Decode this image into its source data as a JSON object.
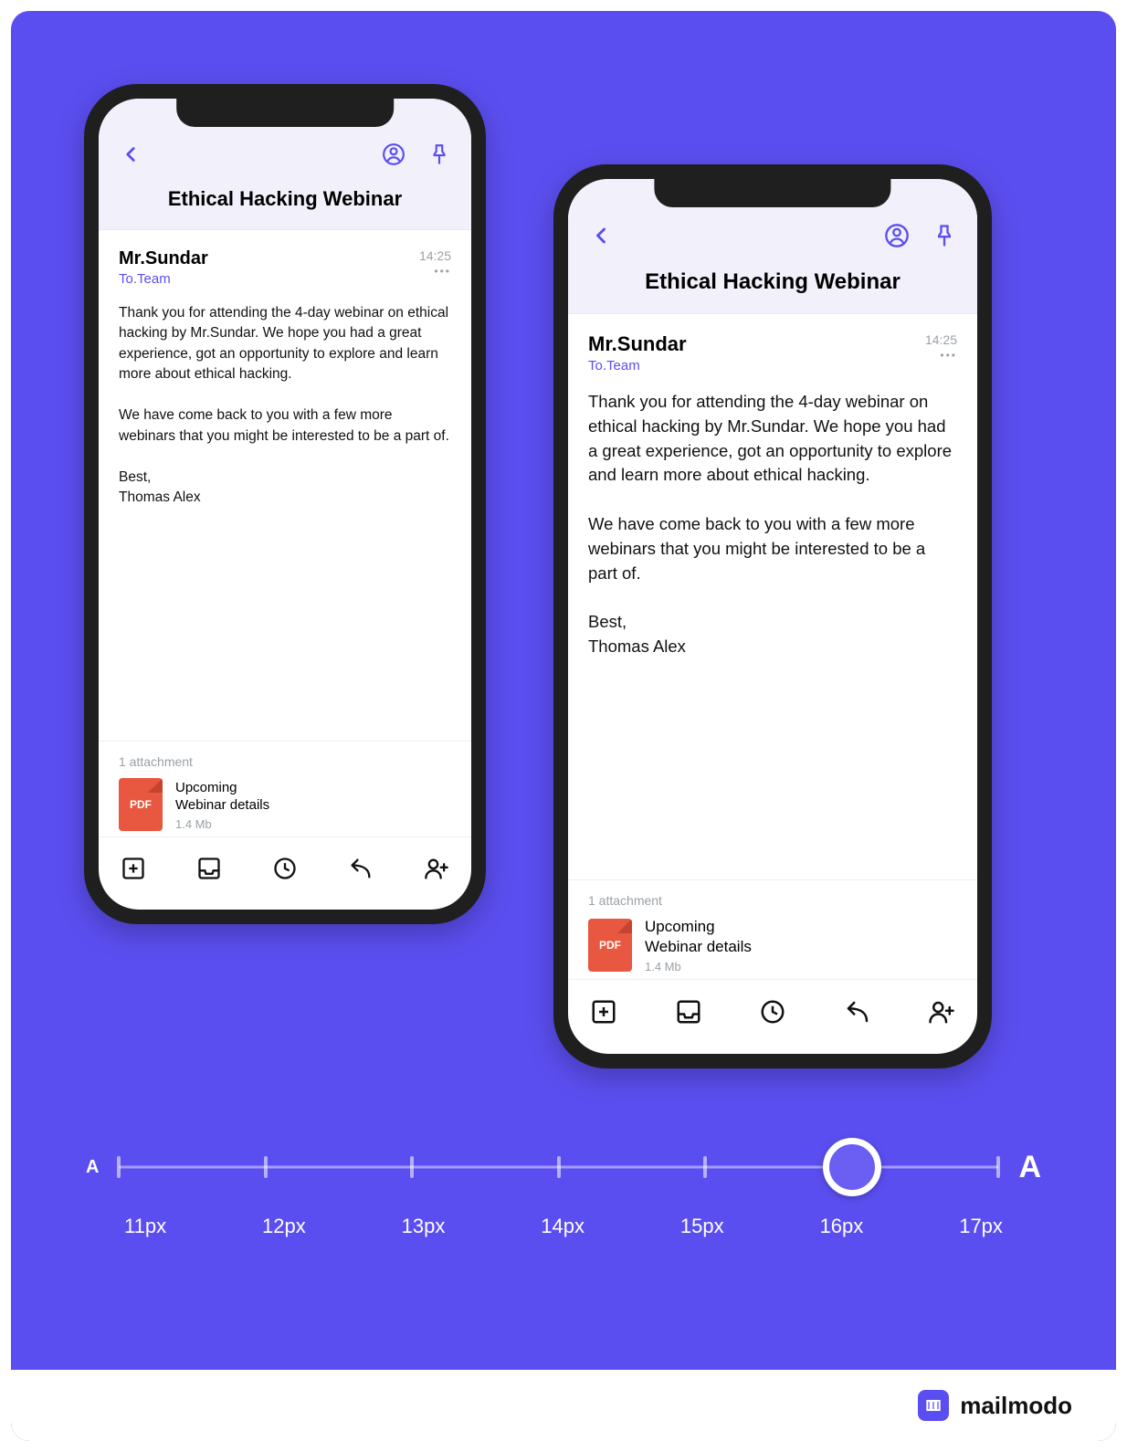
{
  "email": {
    "subject": "Ethical Hacking Webinar",
    "sender": "Mr.Sundar",
    "to": "To.Team",
    "time": "14:25",
    "body": "Thank you for attending the 4-day webinar on ethical hacking by Mr.Sundar. We hope you had a great experience, got an opportunity to explore and learn more about ethical hacking.\n\nWe have come back to you with a few more webinars that you might be interested to be a part of.\n\nBest,\nThomas Alex",
    "attachment_count_label": "1 attachment",
    "attachment": {
      "type_label": "PDF",
      "name_line1": "Upcoming",
      "name_line2": "Webinar details",
      "size": "1.4 Mb"
    }
  },
  "slider": {
    "labels": [
      "11px",
      "12px",
      "13px",
      "14px",
      "15px",
      "16px",
      "17px"
    ],
    "selected_index": 5,
    "small_A": "A",
    "large_A": "A"
  },
  "brand": {
    "name": "mailmodo"
  },
  "colors": {
    "accent": "#5b4ef0",
    "pdf": "#e8573f"
  }
}
